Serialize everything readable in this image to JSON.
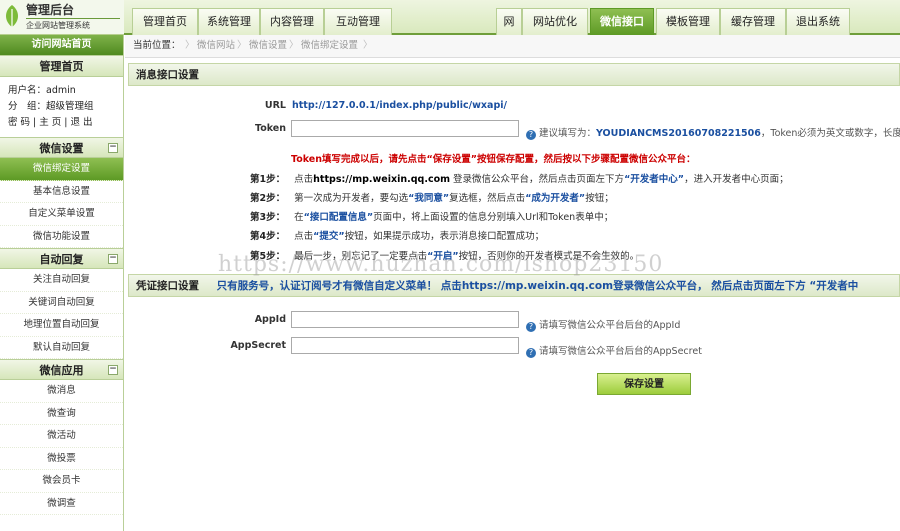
{
  "logo": {
    "title": "管理后台",
    "subtitle": "企业网站管理系统"
  },
  "topnav": [
    {
      "label": "管理首页",
      "active": false
    },
    {
      "label": "系统管理",
      "active": false
    },
    {
      "label": "内容管理",
      "active": false
    },
    {
      "label": "互动管理",
      "active": false
    },
    {
      "label": "网",
      "active": false
    },
    {
      "label": "网站优化",
      "active": false
    },
    {
      "label": "微信接口",
      "active": true
    },
    {
      "label": "模板管理",
      "active": false
    },
    {
      "label": "缓存管理",
      "active": false
    },
    {
      "label": "退出系统",
      "active": false
    }
  ],
  "sidebar": {
    "visit_label": "访问网站首页",
    "home_header": "管理首页",
    "user_line": "用户名：admin",
    "group_line": "分　组：超级管理组",
    "links_line": "密 码 | 主 页 | 退 出",
    "sections": [
      {
        "title": "微信设置",
        "toggle": "−",
        "items": [
          "微信绑定设置",
          "基本信息设置",
          "自定义菜单设置",
          "微信功能设置"
        ],
        "active_index": 0
      },
      {
        "title": "自动回复",
        "toggle": "−",
        "items": [
          "关注自动回复",
          "关键词自动回复",
          "地理位置自动回复",
          "默认自动回复"
        ],
        "active_index": -1
      },
      {
        "title": "微信应用",
        "toggle": "−",
        "items": [
          "微消息",
          "微查询",
          "微活动",
          "微投票",
          "微会员卡",
          "微调查"
        ],
        "active_index": -1
      }
    ]
  },
  "breadcrumb": {
    "label": "当前位置：",
    "items": [
      "微信网站",
      "微信设置",
      "微信绑定设置"
    ]
  },
  "message_panel": {
    "title": "消息接口设置",
    "url_label": "URL",
    "url_value": "http://127.0.0.1/index.php/public/wxapi/",
    "token_label": "Token",
    "token_value": "",
    "token_hint_prefix": "建议填写为：",
    "token_hint_value": "YOUDIANCMS20160708221506",
    "token_hint_suffix": "，Token必须为英文或数字，长度为",
    "warning": "Token填写完成以后，请先点击“保存设置”按钮保存配置，然后按以下步骤配置微信公众平台：",
    "steps": [
      {
        "label": "第1步：",
        "pre": "点击",
        "link": "https://mp.weixin.qq.com",
        "mid": " 登录微信公众平台，然后点击页面左下方",
        "em": "“开发者中心”",
        "post": "，进入开发者中心页面；"
      },
      {
        "label": "第2步：",
        "pre": "第一次成为开发者，要勾选",
        "link": "“我同意”",
        "mid": "复选框，然后点击",
        "em": "“成为开发者”",
        "post": "按钮；"
      },
      {
        "label": "第3步：",
        "pre": "在",
        "link": "“接口配置信息”",
        "mid": "页面中，将上面设置的信息分别填入Url和Token表单中；",
        "em": "",
        "post": ""
      },
      {
        "label": "第4步：",
        "pre": "点击",
        "link": "“提交”",
        "mid": "按钮，如果提示成功，表示消息接口配置成功；",
        "em": "",
        "post": ""
      },
      {
        "label": "第5步：",
        "pre": "最后一步，别忘记了一定要点击",
        "link": "“开启”",
        "mid": "按钮，否则你的开发者模式是不会生效的。",
        "em": "",
        "post": ""
      }
    ]
  },
  "credential_panel": {
    "title": "凭证接口设置",
    "note_blue": "只有服务号，认证订阅号才有微信自定义菜单！ 点击",
    "note_link": "https://mp.weixin.qq.com",
    "note_tail": "登录微信公众平台， 然后点击页面左下方 “开发者中",
    "appid_label": "AppId",
    "appid_value": "",
    "appid_hint": "请填写微信公众平台后台的AppId",
    "secret_label": "AppSecret",
    "secret_value": "",
    "secret_hint": "请填写微信公众平台后台的AppSecret"
  },
  "save_label": "保存设置",
  "watermark": "https://www.huzhan.com/ishop23150",
  "colors": {
    "accent": "#5d9a25",
    "link_blue": "#1a4fa0",
    "warning_red": "#cc0000"
  }
}
